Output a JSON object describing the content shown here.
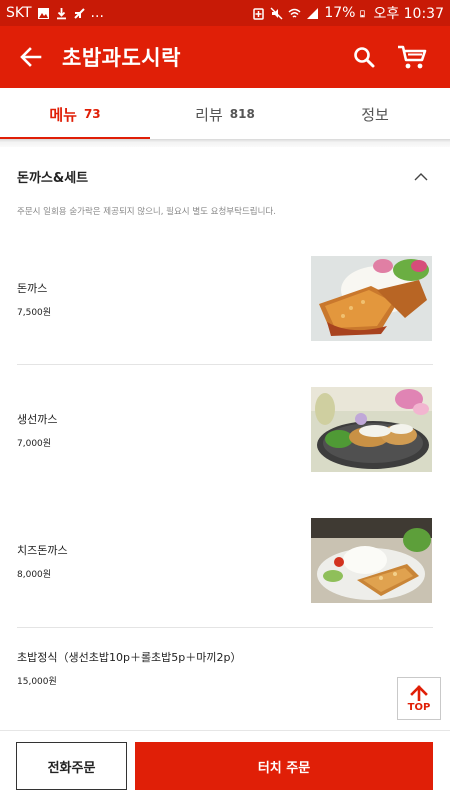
{
  "status_bar": {
    "carrier": "SKT",
    "more": "...",
    "battery": "17%",
    "time": "오후 10:37"
  },
  "header": {
    "title": "초밥과도시락",
    "icons": [
      "back-arrow-icon",
      "search-icon",
      "cart-icon"
    ]
  },
  "tabs": [
    {
      "label": "메뉴",
      "count": "73",
      "active": true
    },
    {
      "label": "리뷰",
      "count": "818",
      "active": false
    },
    {
      "label": "정보",
      "count": "",
      "active": false
    }
  ],
  "section": {
    "title": "돈까스&세트",
    "note": "주문시 일회용 숟가락은 제공되지 않으니, 필요시 별도 요청부탁드립니다.",
    "expanded": true
  },
  "menu_items": [
    {
      "name": "돈까스",
      "price": "7,500원"
    },
    {
      "name": "생선까스",
      "price": "7,000원"
    },
    {
      "name": "치즈돈까스",
      "price": "8,000원"
    },
    {
      "name": "초밥정식（생선초밥10p＋롤초밥5p＋마끼2p）",
      "price": "15,000원"
    }
  ],
  "top_button": {
    "label": "TOP"
  },
  "bottom_bar": {
    "phone_order": "전화주문",
    "touch_order": "터치 주문"
  },
  "colors": {
    "brand_red": "#e01f07",
    "status_bar_red": "#c81a06",
    "text": "#222222"
  }
}
